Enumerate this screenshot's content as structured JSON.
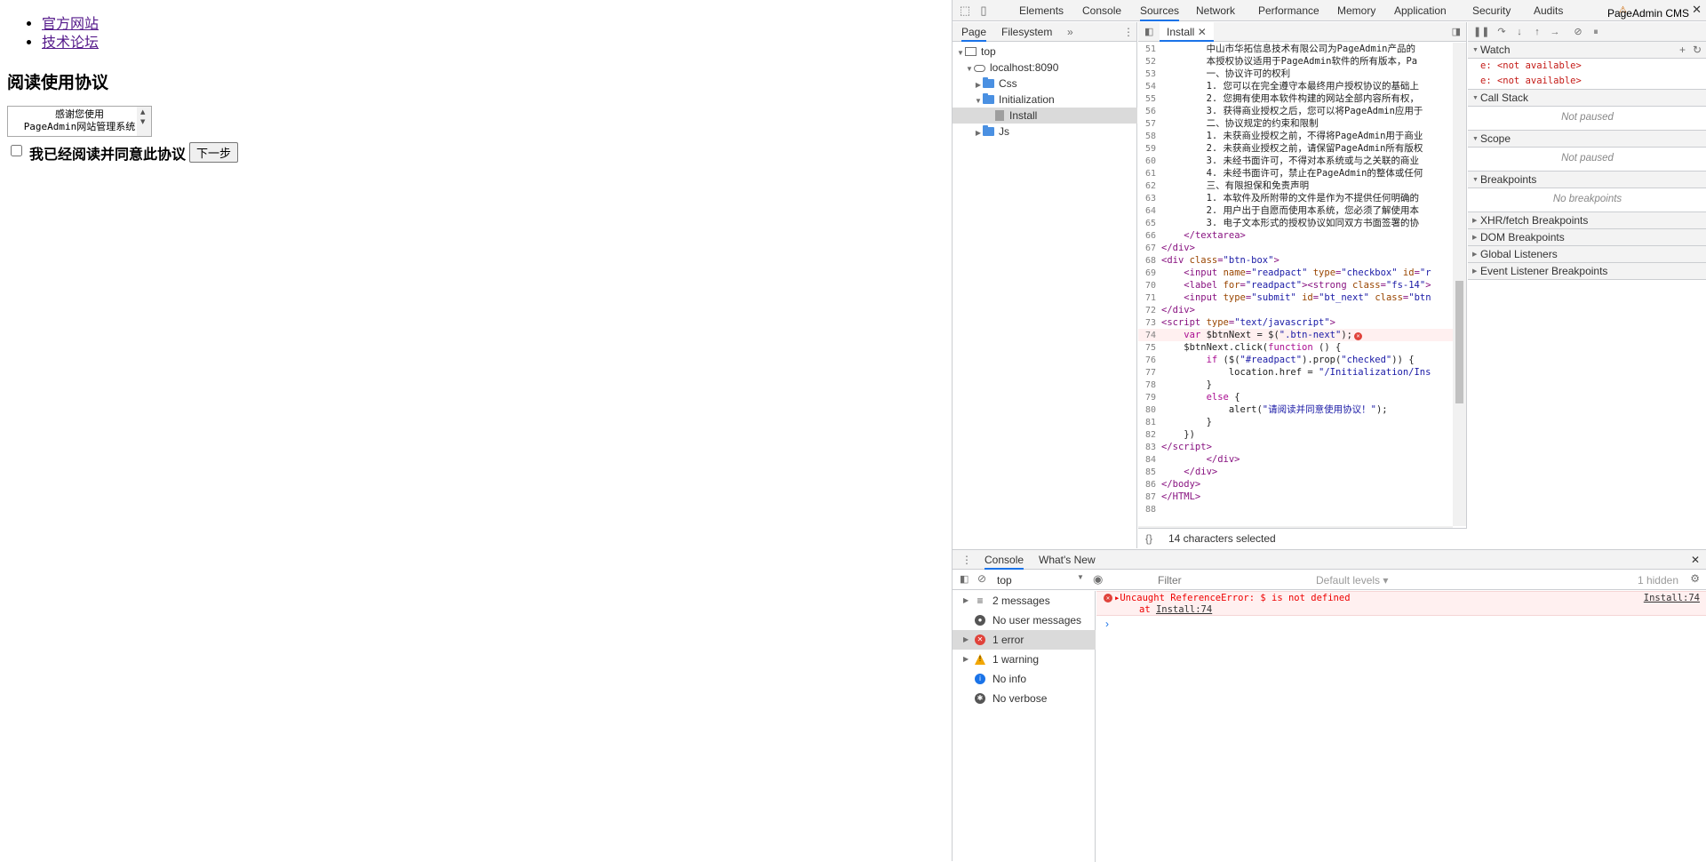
{
  "page": {
    "links": [
      "官方网站",
      "技术论坛"
    ],
    "heading": "阅读使用协议",
    "textarea_text": "感谢您使用\nPageAdmin网站管理系统",
    "checkbox_label": "我已经阅读并同意此协议",
    "next_button": "下一步"
  },
  "devtools": {
    "title": "PageAdmin CMS",
    "tabs": [
      "Elements",
      "Console",
      "Sources",
      "Network",
      "Performance",
      "Memory",
      "Application",
      "Security",
      "Audits"
    ],
    "active_tab": "Sources",
    "navigator": {
      "tabs": [
        "Page",
        "Filesystem"
      ],
      "more": "»",
      "tree": [
        {
          "label": "top",
          "level": 0,
          "icon": "frame"
        },
        {
          "label": "localhost:8090",
          "level": 1,
          "icon": "cloud"
        },
        {
          "label": "Css",
          "level": 2,
          "icon": "folder"
        },
        {
          "label": "Initialization",
          "level": 2,
          "icon": "folder"
        },
        {
          "label": "Install",
          "level": 3,
          "icon": "file"
        },
        {
          "label": "Js",
          "level": 2,
          "icon": "folder"
        }
      ]
    },
    "editor": {
      "tab": "Install",
      "status": "14 characters selected",
      "lines": [
        {
          "n": "51",
          "html": "        <span class='txt'>中山市华拓信息技术有限公司为PageAdmin产品的</span>"
        },
        {
          "n": "52",
          "html": "        <span class='txt'>本授权协议适用于PageAdmin软件的所有版本，Pa</span>"
        },
        {
          "n": "53",
          "html": "        <span class='txt'>一、协议许可的权利</span>"
        },
        {
          "n": "54",
          "html": "        <span class='txt'>1. 您可以在完全遵守本最终用户授权协议的基础上</span>"
        },
        {
          "n": "55",
          "html": "        <span class='txt'>2. 您拥有使用本软件构建的网站全部内容所有权，</span>"
        },
        {
          "n": "56",
          "html": "        <span class='txt'>3. 获得商业授权之后，您可以将PageAdmin应用于</span>"
        },
        {
          "n": "57",
          "html": "        <span class='txt'>二、协议规定的约束和限制</span>"
        },
        {
          "n": "58",
          "html": "        <span class='txt'>1. 未获商业授权之前，不得将PageAdmin用于商业</span>"
        },
        {
          "n": "59",
          "html": "        <span class='txt'>2. 未获商业授权之前，请保留PageAdmin所有版权</span>"
        },
        {
          "n": "60",
          "html": "        <span class='txt'>3. 未经书面许可，不得对本系统或与之关联的商业</span>"
        },
        {
          "n": "61",
          "html": "        <span class='txt'>4. 未经书面许可，禁止在PageAdmin的整体或任何</span>"
        },
        {
          "n": "62",
          "html": "        <span class='txt'>三、有限担保和免责声明</span>"
        },
        {
          "n": "63",
          "html": "        <span class='txt'>1. 本软件及所附带的文件是作为不提供任何明确的</span>"
        },
        {
          "n": "64",
          "html": "        <span class='txt'>2. 用户出于自愿而使用本系统，您必须了解使用本</span>"
        },
        {
          "n": "65",
          "html": "        <span class='txt'>3. 电子文本形式的授权协议如同双方书面签署的协</span>"
        },
        {
          "n": "66",
          "html": "    <span class='tag'>&lt;/textarea&gt;</span>"
        },
        {
          "n": "67",
          "html": "<span class='tag'>&lt;/div&gt;</span>"
        },
        {
          "n": "68",
          "html": "<span class='tag'>&lt;div </span><span class='attr'>class</span><span class='tag'>=</span><span class='str'>\"btn-box\"</span><span class='tag'>&gt;</span>"
        },
        {
          "n": "69",
          "html": "    <span class='tag'>&lt;input </span><span class='attr'>name</span><span class='tag'>=</span><span class='str'>\"readpact\"</span> <span class='attr'>type</span><span class='tag'>=</span><span class='str'>\"checkbox\"</span> <span class='attr'>id</span><span class='tag'>=</span><span class='str'>\"r</span>"
        },
        {
          "n": "70",
          "html": "    <span class='tag'>&lt;label </span><span class='attr'>for</span><span class='tag'>=</span><span class='str'>\"readpact\"</span><span class='tag'>&gt;&lt;strong </span><span class='attr'>class</span><span class='tag'>=</span><span class='str'>\"fs-14\"</span><span class='tag'>&gt;</span>"
        },
        {
          "n": "71",
          "html": "    <span class='tag'>&lt;input </span><span class='attr'>type</span><span class='tag'>=</span><span class='str'>\"submit\"</span> <span class='attr'>id</span><span class='tag'>=</span><span class='str'>\"bt_next\"</span> <span class='attr'>class</span><span class='tag'>=</span><span class='str'>\"btn</span>"
        },
        {
          "n": "72",
          "html": "<span class='tag'>&lt;/div&gt;</span>"
        },
        {
          "n": "73",
          "html": "<span class='tag'>&lt;script </span><span class='attr'>type</span><span class='tag'>=</span><span class='str'>\"text/javascript\"</span><span class='tag'>&gt;</span>"
        },
        {
          "n": "74",
          "html": "    <span class='kw'>var</span> <span class='txt'>$btnNext = $(</span><span class='str'>\".btn-next\"</span><span class='txt'>);</span>",
          "error": true
        },
        {
          "n": "75",
          "html": "    <span class='txt'>$btnNext.click(</span><span class='kw'>function</span><span class='txt'> () {</span>"
        },
        {
          "n": "76",
          "html": "        <span class='kw'>if</span><span class='txt'> ($(</span><span class='str'>\"#readpact\"</span><span class='txt'>).prop(</span><span class='str'>\"checked\"</span><span class='txt'>)) {</span>"
        },
        {
          "n": "77",
          "html": "            <span class='txt'>location.href = </span><span class='str'>\"/Initialization/Ins</span>"
        },
        {
          "n": "78",
          "html": "        <span class='txt'>}</span>"
        },
        {
          "n": "79",
          "html": "        <span class='kw'>else</span><span class='txt'> {</span>"
        },
        {
          "n": "80",
          "html": "            <span class='txt'>alert(</span><span class='str'>\"请阅读并同意使用协议！\"</span><span class='txt'>);</span>"
        },
        {
          "n": "81",
          "html": "        <span class='txt'>}</span>"
        },
        {
          "n": "82",
          "html": "    <span class='txt'>})</span>"
        },
        {
          "n": "83",
          "html": "<span class='tag'>&lt;/script&gt;</span>"
        },
        {
          "n": "84",
          "html": "        <span class='tag'>&lt;/div&gt;</span>"
        },
        {
          "n": "85",
          "html": "    <span class='tag'>&lt;/div&gt;</span>"
        },
        {
          "n": "86",
          "html": "<span class='tag'>&lt;/body&gt;</span>"
        },
        {
          "n": "87",
          "html": "<span class='tag'>&lt;/HTML&gt;</span>"
        },
        {
          "n": "88",
          "html": ""
        }
      ]
    },
    "debugger": {
      "watch_label": "Watch",
      "watch_rows": [
        "e: <not available>",
        "e: <not available>"
      ],
      "sections": [
        {
          "label": "Call Stack",
          "expanded": true,
          "empty": "Not paused"
        },
        {
          "label": "Scope",
          "expanded": true,
          "empty": "Not paused"
        },
        {
          "label": "Breakpoints",
          "expanded": true,
          "empty": "No breakpoints"
        },
        {
          "label": "XHR/fetch Breakpoints",
          "expanded": false
        },
        {
          "label": "DOM Breakpoints",
          "expanded": false
        },
        {
          "label": "Global Listeners",
          "expanded": false
        },
        {
          "label": "Event Listener Breakpoints",
          "expanded": false
        }
      ]
    },
    "drawer": {
      "tabs": [
        "Console",
        "What's New"
      ],
      "context": "top",
      "filter_placeholder": "Filter",
      "levels": "Default levels",
      "hidden": "1 hidden",
      "sidebar": [
        {
          "label": "2 messages",
          "icon": "list",
          "expandable": true,
          "color": "#555555"
        },
        {
          "label": "No user messages",
          "icon": "user",
          "expandable": false,
          "color": "#555555"
        },
        {
          "label": "1 error",
          "icon": "error",
          "expandable": true,
          "color": "#e0423a",
          "selected": true
        },
        {
          "label": "1 warning",
          "icon": "warning",
          "expandable": true,
          "color": "#f2a600"
        },
        {
          "label": "No info",
          "icon": "info",
          "expandable": false,
          "color": "#1a73e8"
        },
        {
          "label": "No verbose",
          "icon": "bug",
          "expandable": false,
          "color": "#555555"
        }
      ],
      "error_line1": "Uncaught ReferenceError: $ is not defined",
      "error_line2": "at Install:74",
      "error_source": "Install:74"
    }
  }
}
